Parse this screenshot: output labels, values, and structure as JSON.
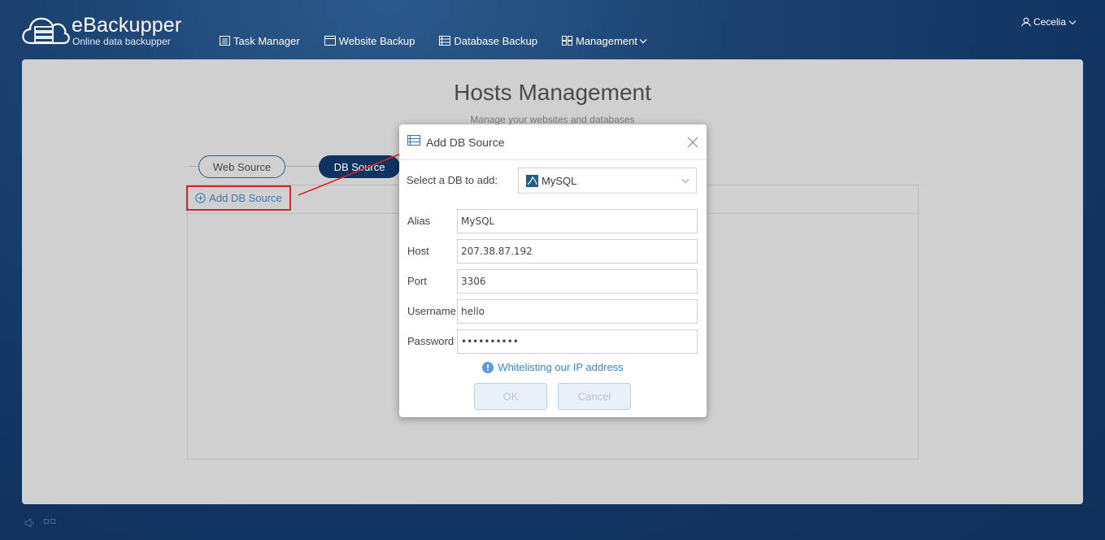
{
  "app": {
    "name": "eBackupper",
    "tagline": "Online data backupper"
  },
  "nav": {
    "items": [
      {
        "label": "Task Manager",
        "icon": "task-list-icon"
      },
      {
        "label": "Website Backup",
        "icon": "browser-window-icon"
      },
      {
        "label": "Database Backup",
        "icon": "database-list-icon"
      },
      {
        "label": "Management",
        "icon": "grid-icon"
      }
    ]
  },
  "user": {
    "name": "Cecelia"
  },
  "page": {
    "title": "Hosts Management",
    "subtitle": "Manage your websites and databases",
    "tabs": {
      "web": "Web Source",
      "db": "DB Source"
    },
    "add_button": "Add DB Source"
  },
  "modal": {
    "title": "Add DB Source",
    "select_label": "Select a DB to add:",
    "selected_db": "MySQL",
    "fields": {
      "alias": {
        "label": "Alias",
        "value": "MySQL"
      },
      "host": {
        "label": "Host",
        "value": "207.38.87.192"
      },
      "port": {
        "label": "Port",
        "value": "3306"
      },
      "username": {
        "label": "Username",
        "value": "hello"
      },
      "password": {
        "label": "Password",
        "value": "••••••••••"
      }
    },
    "whitelist_link": "Whitelisting our IP address",
    "ok_label": "OK",
    "cancel_label": "Cancel"
  },
  "colors": {
    "header_bg": "#123462",
    "accent": "#0f3360",
    "link": "#3b86c8",
    "highlight": "#e02020"
  }
}
